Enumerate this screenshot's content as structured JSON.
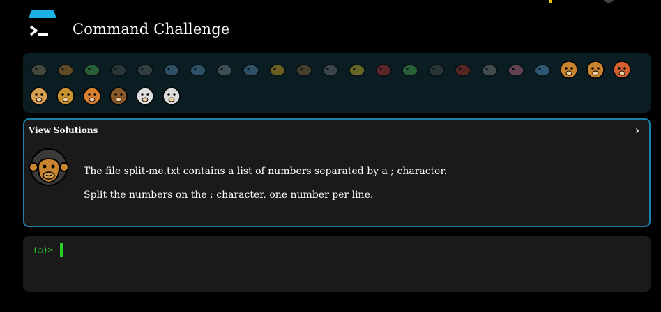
{
  "app": {
    "title": "Command Challenge"
  },
  "animals": [
    {
      "name": "snail",
      "icon": "snail-icon",
      "state": "done"
    },
    {
      "name": "butterfly",
      "icon": "butterfly-icon",
      "state": "done"
    },
    {
      "name": "caterpillar",
      "icon": "caterpillar-icon",
      "state": "done"
    },
    {
      "name": "ant",
      "icon": "ant-icon",
      "state": "done"
    },
    {
      "name": "spider web",
      "icon": "spider-web-icon",
      "state": "done"
    },
    {
      "name": "whale",
      "icon": "whale-icon",
      "state": "done"
    },
    {
      "name": "dolphin",
      "icon": "dolphin-icon",
      "state": "done"
    },
    {
      "name": "shark",
      "icon": "shark-icon",
      "state": "done"
    },
    {
      "name": "fish",
      "icon": "fish-icon",
      "state": "done"
    },
    {
      "name": "tropical fish",
      "icon": "tropical-fish-icon",
      "state": "done"
    },
    {
      "name": "blowfish",
      "icon": "blowfish-icon",
      "state": "done"
    },
    {
      "name": "wolf",
      "icon": "wolf-icon",
      "state": "done"
    },
    {
      "name": "bee",
      "icon": "bee-icon",
      "state": "done"
    },
    {
      "name": "ladybug",
      "icon": "ladybug-icon",
      "state": "done"
    },
    {
      "name": "cricket",
      "icon": "cricket-icon",
      "state": "done"
    },
    {
      "name": "spider",
      "icon": "spider-icon",
      "state": "done"
    },
    {
      "name": "scorpion",
      "icon": "scorpion-icon",
      "state": "done"
    },
    {
      "name": "fly",
      "icon": "fly-icon",
      "state": "done"
    },
    {
      "name": "worm",
      "icon": "worm-icon",
      "state": "done"
    },
    {
      "name": "microbe",
      "icon": "microbe-icon",
      "state": "done"
    },
    {
      "name": "monkey",
      "icon": "monkey-icon",
      "state": "current"
    },
    {
      "name": "dog",
      "icon": "dog-icon",
      "state": "locked"
    },
    {
      "name": "fox",
      "icon": "fox-icon",
      "state": "locked"
    },
    {
      "name": "cat",
      "icon": "cat-icon",
      "state": "locked"
    },
    {
      "name": "lion",
      "icon": "lion-icon",
      "state": "locked"
    },
    {
      "name": "tiger",
      "icon": "tiger-icon",
      "state": "locked"
    },
    {
      "name": "horse",
      "icon": "horse-icon",
      "state": "locked"
    },
    {
      "name": "unicorn",
      "icon": "unicorn-icon",
      "state": "locked"
    },
    {
      "name": "cow",
      "icon": "cow-icon",
      "state": "locked"
    }
  ],
  "solutions_panel": {
    "title": "View Solutions",
    "toggle_glyph": "›",
    "avatar_icon": "monkey-icon",
    "line1": "The file split-me.txt contains a list of numbers separated by a ; character.",
    "line2": "Split the numbers on the ; character, one number per line."
  },
  "terminal": {
    "prompt": "(○)>",
    "input_value": ""
  },
  "colors": {
    "background": "#000000",
    "animal_bar": "#0a1d23",
    "panel": "#1a1a1a",
    "panel_border": "#1a7ea8",
    "prompt": "#2ad02a",
    "logo_arc": "#1bb3e6"
  }
}
